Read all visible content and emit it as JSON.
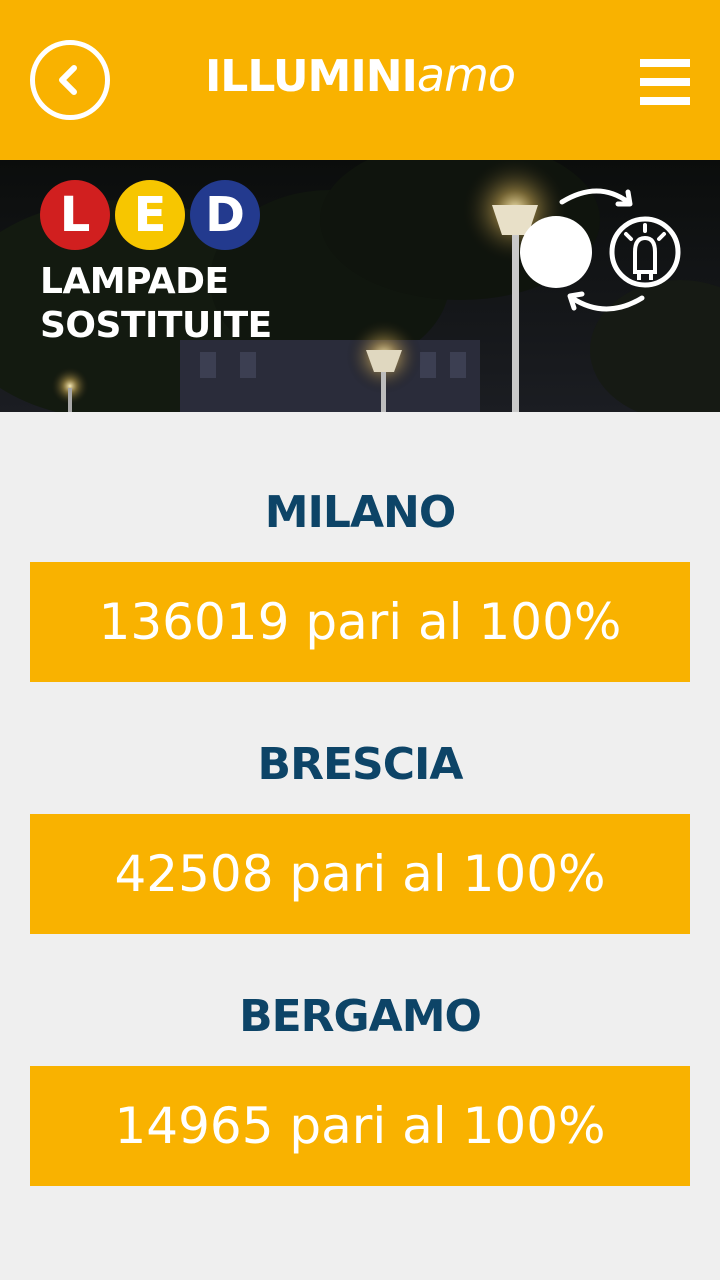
{
  "header": {
    "brand_bold": "ILLUMINI",
    "brand_light": "amo",
    "back_icon": "back-arrow-icon",
    "menu_icon": "hamburger-menu-icon",
    "color": "#f9b200"
  },
  "banner": {
    "led_letters": [
      "L",
      "E",
      "D"
    ],
    "led_colors": [
      "#d11f1f",
      "#f7c600",
      "#233a8e"
    ],
    "title_line1": "LAMPADE",
    "title_line2": "SOSTITUITE",
    "swap_icon": "lamp-replace-icon"
  },
  "cities": [
    {
      "name": "MILANO",
      "value": "136019 pari al 100%"
    },
    {
      "name": "BRESCIA",
      "value": "42508 pari al 100%"
    },
    {
      "name": "BERGAMO",
      "value": "14965 pari al 100%"
    }
  ],
  "colors": {
    "accent": "#f9b200",
    "title_blue": "#0d4467",
    "background": "#efefef"
  }
}
